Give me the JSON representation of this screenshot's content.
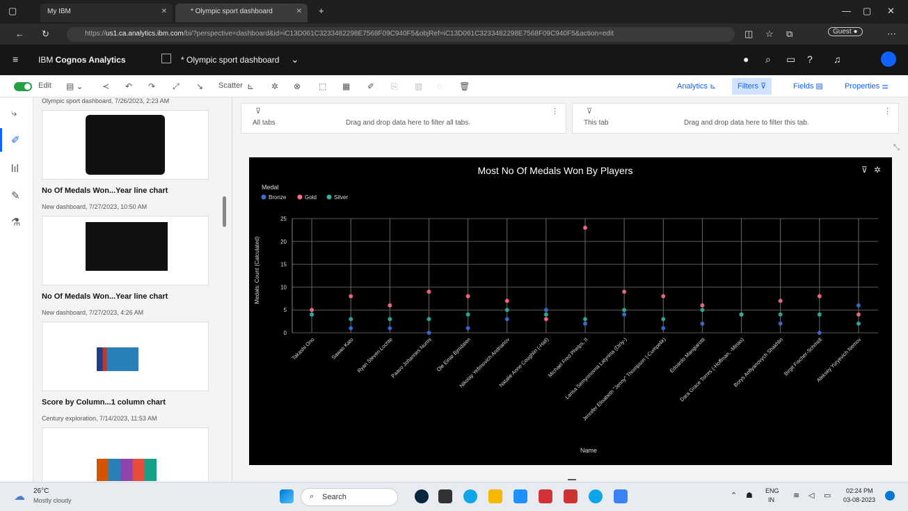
{
  "browser": {
    "tabs": [
      {
        "label": "My IBM"
      },
      {
        "label": "* Olympic sport dashboard"
      }
    ],
    "url_prefix": "https://",
    "url_host": "us1.ca.analytics.ibm.com",
    "url_rest": "/bi/?perspective=dashboard&id=iC13D061C3233482298E7568F09C940F5&objRef=iC13D061C3233482298E7568F09C940F5&action=edit"
  },
  "app": {
    "brand_light": "IBM ",
    "brand_bold": "Cognos Analytics",
    "dashboard_title": "* Olympic sport dashboard"
  },
  "toolbar": {
    "edit_label": "Edit",
    "scatter_label": "Scatter",
    "analytics_label": "Analytics",
    "filters_label": "Filters",
    "fields_label": "Fields",
    "properties_label": "Properties"
  },
  "panel": {
    "top_caption": "Olympic sport dashboard, 7/26/2023, 2:23 AM",
    "cards": [
      {
        "title": "No Of Medals Won...Year line chart",
        "subtitle": "New dashboard, 7/27/2023, 10:50 AM"
      },
      {
        "title": "No Of Medals Won...Year line chart",
        "subtitle": "New dashboard, 7/27/2023, 4:26 AM"
      },
      {
        "title": "Score by Column...1 column chart",
        "subtitle": "Century exploration, 7/14/2023, 11:53 AM"
      }
    ]
  },
  "filters": {
    "all_tabs_label": "All tabs",
    "all_tabs_hint": "Drag and drop data here to filter all tabs.",
    "this_tab_label": "This tab",
    "this_tab_hint": "Drag and drop data here to filter this tab."
  },
  "chart_data": {
    "type": "scatter",
    "title": "Most No Of Medals Won By Players",
    "legend_title": "Medal",
    "legend_position": "top-left",
    "xlabel": "Name",
    "ylabel": "Medals: Count (Calculated)",
    "ylim": [
      0,
      25
    ],
    "yticks": [
      0,
      5,
      10,
      15,
      20,
      25
    ],
    "grid": true,
    "colors": {
      "Bronze": "#3a6fd8",
      "Gold": "#ff6b8a",
      "Silver": "#2bb3a3"
    },
    "categories": [
      "Takashi Ono",
      "Sawao Kato",
      "Ryan Steven Lochte",
      "Paavo Johannes Nurmi",
      "Ole Einar Bjrndalen",
      "Nikolay Yefimovich Andrianov",
      "Natalie Anne Coughlin (-Hall)",
      "Michael Fred Phelps, II",
      "Larisa Semyonovna Latynina (Diriy-)",
      "Jennifer Elisabeth \"Jenny\" Thompson (-Cumpelik)",
      "Edoardo Mangiarotti",
      "Dara Grace Torres (-Hoffman, -Minas)",
      "Borys Anfiyanovych Shakhlin",
      "Birgit Fischer-Schmidt",
      "Aleksey Yuryevich Nemov"
    ],
    "series": [
      {
        "name": "Bronze",
        "values": [
          4,
          1,
          1,
          0,
          1,
          3,
          5,
          2,
          4,
          1,
          2,
          4,
          2,
          0,
          6
        ]
      },
      {
        "name": "Gold",
        "values": [
          5,
          8,
          6,
          9,
          8,
          7,
          3,
          23,
          9,
          8,
          6,
          4,
          7,
          8,
          4
        ]
      },
      {
        "name": "Silver",
        "values": [
          4,
          3,
          3,
          3,
          4,
          5,
          4,
          3,
          5,
          3,
          5,
          4,
          4,
          4,
          2
        ]
      }
    ]
  },
  "taskbar": {
    "weather_temp": "26°C",
    "weather_desc": "Mostly cloudy",
    "search_label": "Search",
    "lang_top": "ENG",
    "lang_bottom": "IN",
    "time": "02:24 PM",
    "date": "03-08-2023"
  }
}
